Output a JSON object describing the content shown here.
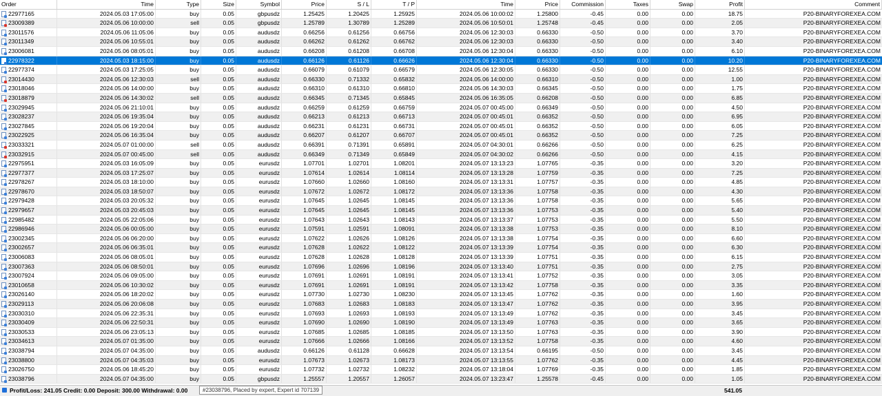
{
  "columns": [
    "Order",
    "Time",
    "Type",
    "Size",
    "Symbol",
    "Price",
    "S / L",
    "T / P",
    "Time",
    "Price",
    "Commission",
    "Taxes",
    "Swap",
    "Profit",
    "Comment"
  ],
  "rows": [
    {
      "order": "22977165",
      "time": "2024.05.03 17:05:00",
      "type": "buy",
      "size": "0.05",
      "symbol": "gbpusdz",
      "price": "1.25425",
      "sl": "1.20425",
      "tp": "1.25925",
      "close_time": "2024.05.06 10:00:02",
      "close_price": "1.25800",
      "commission": "-0.45",
      "taxes": "0.00",
      "swap": "0.00",
      "profit": "18.75",
      "comment": "P20-BINARYFOREXEA.COM"
    },
    {
      "order": "23009389",
      "time": "2024.05.06 10:00:00",
      "type": "sell",
      "size": "0.05",
      "symbol": "gbpusdz",
      "price": "1.25789",
      "sl": "1.30789",
      "tp": "1.25289",
      "close_time": "2024.05.06 10:50:01",
      "close_price": "1.25748",
      "commission": "-0.45",
      "taxes": "0.00",
      "swap": "0.00",
      "profit": "2.05",
      "comment": "P20-BINARYFOREXEA.COM"
    },
    {
      "order": "23011576",
      "time": "2024.05.06 11:05:06",
      "type": "buy",
      "size": "0.05",
      "symbol": "audusdz",
      "price": "0.66256",
      "sl": "0.61256",
      "tp": "0.66756",
      "close_time": "2024.05.06 12:30:03",
      "close_price": "0.66330",
      "commission": "-0.50",
      "taxes": "0.00",
      "swap": "0.00",
      "profit": "3.70",
      "comment": "P20-BINARYFOREXEA.COM"
    },
    {
      "order": "23011349",
      "time": "2024.05.06 10:55:01",
      "type": "buy",
      "size": "0.05",
      "symbol": "audusdz",
      "price": "0.66262",
      "sl": "0.61262",
      "tp": "0.66762",
      "close_time": "2024.05.06 12:30:03",
      "close_price": "0.66330",
      "commission": "-0.50",
      "taxes": "0.00",
      "swap": "0.00",
      "profit": "3.40",
      "comment": "P20-BINARYFOREXEA.COM"
    },
    {
      "order": "23006081",
      "time": "2024.05.06 08:05:01",
      "type": "buy",
      "size": "0.05",
      "symbol": "audusdz",
      "price": "0.66208",
      "sl": "0.61208",
      "tp": "0.66708",
      "close_time": "2024.05.06 12:30:04",
      "close_price": "0.66330",
      "commission": "-0.50",
      "taxes": "0.00",
      "swap": "0.00",
      "profit": "6.10",
      "comment": "P20-BINARYFOREXEA.COM"
    },
    {
      "order": "22978322",
      "time": "2024.05.03 18:15:00",
      "type": "buy",
      "size": "0.05",
      "symbol": "audusdz",
      "price": "0.66126",
      "sl": "0.61126",
      "tp": "0.66626",
      "close_time": "2024.05.06 12:30:04",
      "close_price": "0.66330",
      "commission": "-0.50",
      "taxes": "0.00",
      "swap": "0.00",
      "profit": "10.20",
      "comment": "P20-BINARYFOREXEA.COM",
      "selected": true
    },
    {
      "order": "22977374",
      "time": "2024.05.03 17:25:05",
      "type": "buy",
      "size": "0.05",
      "symbol": "audusdz",
      "price": "0.66079",
      "sl": "0.61079",
      "tp": "0.66579",
      "close_time": "2024.05.06 12:30:05",
      "close_price": "0.66330",
      "commission": "-0.50",
      "taxes": "0.00",
      "swap": "0.00",
      "profit": "12.55",
      "comment": "P20-BINARYFOREXEA.COM"
    },
    {
      "order": "23014430",
      "time": "2024.05.06 12:30:03",
      "type": "sell",
      "size": "0.05",
      "symbol": "audusdz",
      "price": "0.66330",
      "sl": "0.71332",
      "tp": "0.65832",
      "close_time": "2024.05.06 14:00:00",
      "close_price": "0.66310",
      "commission": "-0.50",
      "taxes": "0.00",
      "swap": "0.00",
      "profit": "1.00",
      "comment": "P20-BINARYFOREXEA.COM"
    },
    {
      "order": "23018046",
      "time": "2024.05.06 14:00:00",
      "type": "buy",
      "size": "0.05",
      "symbol": "audusdz",
      "price": "0.66310",
      "sl": "0.61310",
      "tp": "0.66810",
      "close_time": "2024.05.06 14:30:03",
      "close_price": "0.66345",
      "commission": "-0.50",
      "taxes": "0.00",
      "swap": "0.00",
      "profit": "1.75",
      "comment": "P20-BINARYFOREXEA.COM"
    },
    {
      "order": "23018879",
      "time": "2024.05.06 14:30:02",
      "type": "sell",
      "size": "0.05",
      "symbol": "audusdz",
      "price": "0.66345",
      "sl": "0.71345",
      "tp": "0.65845",
      "close_time": "2024.05.06 16:35:05",
      "close_price": "0.66208",
      "commission": "-0.50",
      "taxes": "0.00",
      "swap": "0.00",
      "profit": "6.85",
      "comment": "P20-BINARYFOREXEA.COM"
    },
    {
      "order": "23029945",
      "time": "2024.05.06 21:10:01",
      "type": "buy",
      "size": "0.05",
      "symbol": "audusdz",
      "price": "0.66259",
      "sl": "0.61259",
      "tp": "0.66759",
      "close_time": "2024.05.07 00:45:00",
      "close_price": "0.66349",
      "commission": "-0.50",
      "taxes": "0.00",
      "swap": "0.00",
      "profit": "4.50",
      "comment": "P20-BINARYFOREXEA.COM"
    },
    {
      "order": "23028237",
      "time": "2024.05.06 19:35:04",
      "type": "buy",
      "size": "0.05",
      "symbol": "audusdz",
      "price": "0.66213",
      "sl": "0.61213",
      "tp": "0.66713",
      "close_time": "2024.05.07 00:45:01",
      "close_price": "0.66352",
      "commission": "-0.50",
      "taxes": "0.00",
      "swap": "0.00",
      "profit": "6.95",
      "comment": "P20-BINARYFOREXEA.COM"
    },
    {
      "order": "23027845",
      "time": "2024.05.06 19:20:04",
      "type": "buy",
      "size": "0.05",
      "symbol": "audusdz",
      "price": "0.66231",
      "sl": "0.61231",
      "tp": "0.66731",
      "close_time": "2024.05.07 00:45:01",
      "close_price": "0.66352",
      "commission": "-0.50",
      "taxes": "0.00",
      "swap": "0.00",
      "profit": "6.05",
      "comment": "P20-BINARYFOREXEA.COM"
    },
    {
      "order": "23022925",
      "time": "2024.05.06 16:35:04",
      "type": "buy",
      "size": "0.05",
      "symbol": "audusdz",
      "price": "0.66207",
      "sl": "0.61207",
      "tp": "0.66707",
      "close_time": "2024.05.07 00:45:01",
      "close_price": "0.66352",
      "commission": "-0.50",
      "taxes": "0.00",
      "swap": "0.00",
      "profit": "7.25",
      "comment": "P20-BINARYFOREXEA.COM"
    },
    {
      "order": "23033321",
      "time": "2024.05.07 01:00:00",
      "type": "sell",
      "size": "0.05",
      "symbol": "audusdz",
      "price": "0.66391",
      "sl": "0.71391",
      "tp": "0.65891",
      "close_time": "2024.05.07 04:30:01",
      "close_price": "0.66266",
      "commission": "-0.50",
      "taxes": "0.00",
      "swap": "0.00",
      "profit": "6.25",
      "comment": "P20-BINARYFOREXEA.COM"
    },
    {
      "order": "23032915",
      "time": "2024.05.07 00:45:00",
      "type": "sell",
      "size": "0.05",
      "symbol": "audusdz",
      "price": "0.66349",
      "sl": "0.71349",
      "tp": "0.65849",
      "close_time": "2024.05.07 04:30:02",
      "close_price": "0.66266",
      "commission": "-0.50",
      "taxes": "0.00",
      "swap": "0.00",
      "profit": "4.15",
      "comment": "P20-BINARYFOREXEA.COM"
    },
    {
      "order": "22975951",
      "time": "2024.05.03 16:05:09",
      "type": "buy",
      "size": "0.05",
      "symbol": "eurusdz",
      "price": "1.07701",
      "sl": "1.02701",
      "tp": "1.08201",
      "close_time": "2024.05.07 13:13:23",
      "close_price": "1.07765",
      "commission": "-0.35",
      "taxes": "0.00",
      "swap": "0.00",
      "profit": "3.20",
      "comment": "P20-BINARYFOREXEA.COM"
    },
    {
      "order": "22977377",
      "time": "2024.05.03 17:25:07",
      "type": "buy",
      "size": "0.05",
      "symbol": "eurusdz",
      "price": "1.07614",
      "sl": "1.02614",
      "tp": "1.08114",
      "close_time": "2024.05.07 13:13:28",
      "close_price": "1.07759",
      "commission": "-0.35",
      "taxes": "0.00",
      "swap": "0.00",
      "profit": "7.25",
      "comment": "P20-BINARYFOREXEA.COM"
    },
    {
      "order": "22978267",
      "time": "2024.05.03 18:10:00",
      "type": "buy",
      "size": "0.05",
      "symbol": "eurusdz",
      "price": "1.07660",
      "sl": "1.02660",
      "tp": "1.08160",
      "close_time": "2024.05.07 13:13:31",
      "close_price": "1.07757",
      "commission": "-0.35",
      "taxes": "0.00",
      "swap": "0.00",
      "profit": "4.85",
      "comment": "P20-BINARYFOREXEA.COM"
    },
    {
      "order": "22978670",
      "time": "2024.05.03 18:50:07",
      "type": "buy",
      "size": "0.05",
      "symbol": "eurusdz",
      "price": "1.07672",
      "sl": "1.02672",
      "tp": "1.08172",
      "close_time": "2024.05.07 13:13:36",
      "close_price": "1.07758",
      "commission": "-0.35",
      "taxes": "0.00",
      "swap": "0.00",
      "profit": "4.30",
      "comment": "P20-BINARYFOREXEA.COM"
    },
    {
      "order": "22979428",
      "time": "2024.05.03 20:05:32",
      "type": "buy",
      "size": "0.05",
      "symbol": "eurusdz",
      "price": "1.07645",
      "sl": "1.02645",
      "tp": "1.08145",
      "close_time": "2024.05.07 13:13:36",
      "close_price": "1.07758",
      "commission": "-0.35",
      "taxes": "0.00",
      "swap": "0.00",
      "profit": "5.65",
      "comment": "P20-BINARYFOREXEA.COM"
    },
    {
      "order": "22979657",
      "time": "2024.05.03 20:45:03",
      "type": "buy",
      "size": "0.05",
      "symbol": "eurusdz",
      "price": "1.07645",
      "sl": "1.02645",
      "tp": "1.08145",
      "close_time": "2024.05.07 13:13:36",
      "close_price": "1.07753",
      "commission": "-0.35",
      "taxes": "0.00",
      "swap": "0.00",
      "profit": "5.40",
      "comment": "P20-BINARYFOREXEA.COM"
    },
    {
      "order": "22985482",
      "time": "2024.05.05 22:05:06",
      "type": "buy",
      "size": "0.05",
      "symbol": "eurusdz",
      "price": "1.07643",
      "sl": "1.02643",
      "tp": "1.08143",
      "close_time": "2024.05.07 13:13:37",
      "close_price": "1.07753",
      "commission": "-0.35",
      "taxes": "0.00",
      "swap": "0.00",
      "profit": "5.50",
      "comment": "P20-BINARYFOREXEA.COM"
    },
    {
      "order": "22986946",
      "time": "2024.05.06 00:05:00",
      "type": "buy",
      "size": "0.05",
      "symbol": "eurusdz",
      "price": "1.07591",
      "sl": "1.02591",
      "tp": "1.08091",
      "close_time": "2024.05.07 13:13:38",
      "close_price": "1.07753",
      "commission": "-0.35",
      "taxes": "0.00",
      "swap": "0.00",
      "profit": "8.10",
      "comment": "P20-BINARYFOREXEA.COM"
    },
    {
      "order": "23002345",
      "time": "2024.05.06 06:20:00",
      "type": "buy",
      "size": "0.05",
      "symbol": "eurusdz",
      "price": "1.07622",
      "sl": "1.02626",
      "tp": "1.08126",
      "close_time": "2024.05.07 13:13:38",
      "close_price": "1.07754",
      "commission": "-0.35",
      "taxes": "0.00",
      "swap": "0.00",
      "profit": "6.60",
      "comment": "P20-BINARYFOREXEA.COM"
    },
    {
      "order": "23002657",
      "time": "2024.05.06 06:35:01",
      "type": "buy",
      "size": "0.05",
      "symbol": "eurusdz",
      "price": "1.07628",
      "sl": "1.02622",
      "tp": "1.08122",
      "close_time": "2024.05.07 13:13:39",
      "close_price": "1.07754",
      "commission": "-0.35",
      "taxes": "0.00",
      "swap": "0.00",
      "profit": "6.30",
      "comment": "P20-BINARYFOREXEA.COM"
    },
    {
      "order": "23006083",
      "time": "2024.05.06 08:05:01",
      "type": "buy",
      "size": "0.05",
      "symbol": "eurusdz",
      "price": "1.07628",
      "sl": "1.02628",
      "tp": "1.08128",
      "close_time": "2024.05.07 13:13:39",
      "close_price": "1.07751",
      "commission": "-0.35",
      "taxes": "0.00",
      "swap": "0.00",
      "profit": "6.15",
      "comment": "P20-BINARYFOREXEA.COM"
    },
    {
      "order": "23007363",
      "time": "2024.05.06 08:50:01",
      "type": "buy",
      "size": "0.05",
      "symbol": "eurusdz",
      "price": "1.07696",
      "sl": "1.02696",
      "tp": "1.08196",
      "close_time": "2024.05.07 13:13:40",
      "close_price": "1.07751",
      "commission": "-0.35",
      "taxes": "0.00",
      "swap": "0.00",
      "profit": "2.75",
      "comment": "P20-BINARYFOREXEA.COM"
    },
    {
      "order": "23007924",
      "time": "2024.05.06 09:05:00",
      "type": "buy",
      "size": "0.05",
      "symbol": "eurusdz",
      "price": "1.07691",
      "sl": "1.02691",
      "tp": "1.08191",
      "close_time": "2024.05.07 13:13:41",
      "close_price": "1.07752",
      "commission": "-0.35",
      "taxes": "0.00",
      "swap": "0.00",
      "profit": "3.05",
      "comment": "P20-BINARYFOREXEA.COM"
    },
    {
      "order": "23010658",
      "time": "2024.05.06 10:30:02",
      "type": "buy",
      "size": "0.05",
      "symbol": "eurusdz",
      "price": "1.07691",
      "sl": "1.02691",
      "tp": "1.08191",
      "close_time": "2024.05.07 13:13:42",
      "close_price": "1.07758",
      "commission": "-0.35",
      "taxes": "0.00",
      "swap": "0.00",
      "profit": "3.35",
      "comment": "P20-BINARYFOREXEA.COM"
    },
    {
      "order": "23026140",
      "time": "2024.05.06 18:20:02",
      "type": "buy",
      "size": "0.05",
      "symbol": "eurusdz",
      "price": "1.07730",
      "sl": "1.02730",
      "tp": "1.08230",
      "close_time": "2024.05.07 13:13:45",
      "close_price": "1.07762",
      "commission": "-0.35",
      "taxes": "0.00",
      "swap": "0.00",
      "profit": "1.60",
      "comment": "P20-BINARYFOREXEA.COM"
    },
    {
      "order": "23029113",
      "time": "2024.05.06 20:06:08",
      "type": "buy",
      "size": "0.05",
      "symbol": "eurusdz",
      "price": "1.07683",
      "sl": "1.02683",
      "tp": "1.08183",
      "close_time": "2024.05.07 13:13:47",
      "close_price": "1.07762",
      "commission": "-0.35",
      "taxes": "0.00",
      "swap": "0.00",
      "profit": "3.95",
      "comment": "P20-BINARYFOREXEA.COM"
    },
    {
      "order": "23030310",
      "time": "2024.05.06 22:35:31",
      "type": "buy",
      "size": "0.05",
      "symbol": "eurusdz",
      "price": "1.07693",
      "sl": "1.02693",
      "tp": "1.08193",
      "close_time": "2024.05.07 13:13:49",
      "close_price": "1.07762",
      "commission": "-0.35",
      "taxes": "0.00",
      "swap": "0.00",
      "profit": "3.45",
      "comment": "P20-BINARYFOREXEA.COM"
    },
    {
      "order": "23030409",
      "time": "2024.05.06 22:50:31",
      "type": "buy",
      "size": "0.05",
      "symbol": "eurusdz",
      "price": "1.07690",
      "sl": "1.02690",
      "tp": "1.08190",
      "close_time": "2024.05.07 13:13:49",
      "close_price": "1.07763",
      "commission": "-0.35",
      "taxes": "0.00",
      "swap": "0.00",
      "profit": "3.65",
      "comment": "P20-BINARYFOREXEA.COM"
    },
    {
      "order": "23030533",
      "time": "2024.05.06 23:05:13",
      "type": "buy",
      "size": "0.05",
      "symbol": "eurusdz",
      "price": "1.07685",
      "sl": "1.02685",
      "tp": "1.08185",
      "close_time": "2024.05.07 13:13:50",
      "close_price": "1.07763",
      "commission": "-0.35",
      "taxes": "0.00",
      "swap": "0.00",
      "profit": "3.90",
      "comment": "P20-BINARYFOREXEA.COM"
    },
    {
      "order": "23034613",
      "time": "2024.05.07 01:35:00",
      "type": "buy",
      "size": "0.05",
      "symbol": "eurusdz",
      "price": "1.07666",
      "sl": "1.02666",
      "tp": "1.08166",
      "close_time": "2024.05.07 13:13:52",
      "close_price": "1.07758",
      "commission": "-0.35",
      "taxes": "0.00",
      "swap": "0.00",
      "profit": "4.60",
      "comment": "P20-BINARYFOREXEA.COM"
    },
    {
      "order": "23038794",
      "time": "2024.05.07 04:35:00",
      "type": "buy",
      "size": "0.05",
      "symbol": "audusdz",
      "price": "0.66126",
      "sl": "0.61128",
      "tp": "0.66628",
      "close_time": "2024.05.07 13:13:54",
      "close_price": "0.66195",
      "commission": "-0.50",
      "taxes": "0.00",
      "swap": "0.00",
      "profit": "3.45",
      "comment": "P20-BINARYFOREXEA.COM"
    },
    {
      "order": "23038800",
      "time": "2024.05.07 04:35:03",
      "type": "buy",
      "size": "0.05",
      "symbol": "eurusdz",
      "price": "1.07673",
      "sl": "1.02673",
      "tp": "1.08173",
      "close_time": "2024.05.07 13:13:55",
      "close_price": "1.07762",
      "commission": "-0.35",
      "taxes": "0.00",
      "swap": "0.00",
      "profit": "4.45",
      "comment": "P20-BINARYFOREXEA.COM"
    },
    {
      "order": "23026750",
      "time": "2024.05.06 18:45:20",
      "type": "buy",
      "size": "0.05",
      "symbol": "eurusdz",
      "price": "1.07732",
      "sl": "1.02732",
      "tp": "1.08232",
      "close_time": "2024.05.07 13:18:04",
      "close_price": "1.07769",
      "commission": "-0.35",
      "taxes": "0.00",
      "swap": "0.00",
      "profit": "1.85",
      "comment": "P20-BINARYFOREXEA.COM"
    },
    {
      "order": "23038796",
      "time": "2024.05.07 04:35:00",
      "type": "buy",
      "size": "0.05",
      "symbol": "gbpusdz",
      "price": "1.25557",
      "sl": "1.20557",
      "tp": "1.26057",
      "close_time": "2024.05.07 13:23:47",
      "close_price": "1.25578",
      "commission": "-0.45",
      "taxes": "0.00",
      "swap": "0.00",
      "profit": "1.05",
      "comment": "P20-BINARYFOREXEA.COM"
    }
  ],
  "footer": {
    "summary": "Profit/Loss: 241.05  Credit: 0.00  Deposit: 300.00  Withdrawal: 0.00",
    "total_profit": "541.05",
    "tooltip": "#23038796, Placed by expert, Expert id 707139"
  },
  "colors": {
    "selection": "#0078d7",
    "alt_row": "#f0f0f0",
    "buy_icon": "#3a7fd8",
    "sell_icon": "#d9342b"
  }
}
